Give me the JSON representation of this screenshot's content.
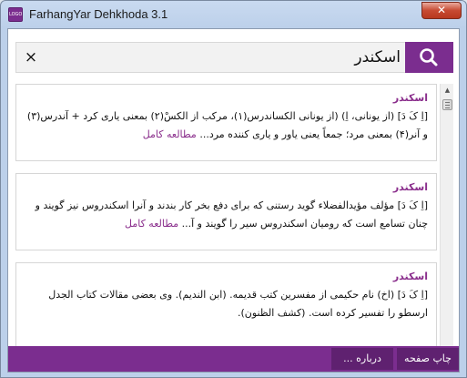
{
  "window": {
    "title": "FarhangYar Dehkhoda 3.1",
    "icon_text": "LOGO",
    "close_glyph": "✕",
    "accent": "#7b2d8f"
  },
  "search": {
    "value": "اسکندر",
    "clear_glyph": "×",
    "search_icon": "search-icon"
  },
  "results": [
    {
      "title": "اسکندر",
      "body": "[اِ کَ دَ] (از یونانی، اِ) (از یونانی الکساندرس(۱)، مرکب از الکسْ(۲) بمعنی یاری کرد + آندرس(۳) و آنر(۴) بمعنی مرد؛ جمعاً یعنی یاور و یاری کننده مرد...",
      "more": "مطالعه کامل"
    },
    {
      "title": "اسکندر",
      "body": "[اِ کَ دَ] مؤلف مؤیدالفضلاء گوید رستنی که برای دفع بخر کار بندند و آنرا اسکندروس نیز گویند و چنان تسامع است که رومیان اسکندروس سیر را گویند و آ...",
      "more": "مطالعه کامل"
    },
    {
      "title": "اسکندر",
      "body": "[اِ کَ دَ] (اخ) نام حکیمی از مفسرین کتب قدیمه. (ابن الندیم). وی بعضی مقالات کتاب الجدل ارسطو را تفسیر کرده است. (کشف الظنون).",
      "more": ""
    }
  ],
  "scrollbar": {
    "up_glyph": "▲"
  },
  "bottom": {
    "print_label": "چاپ صفحه",
    "about_label": "درباره ..."
  }
}
